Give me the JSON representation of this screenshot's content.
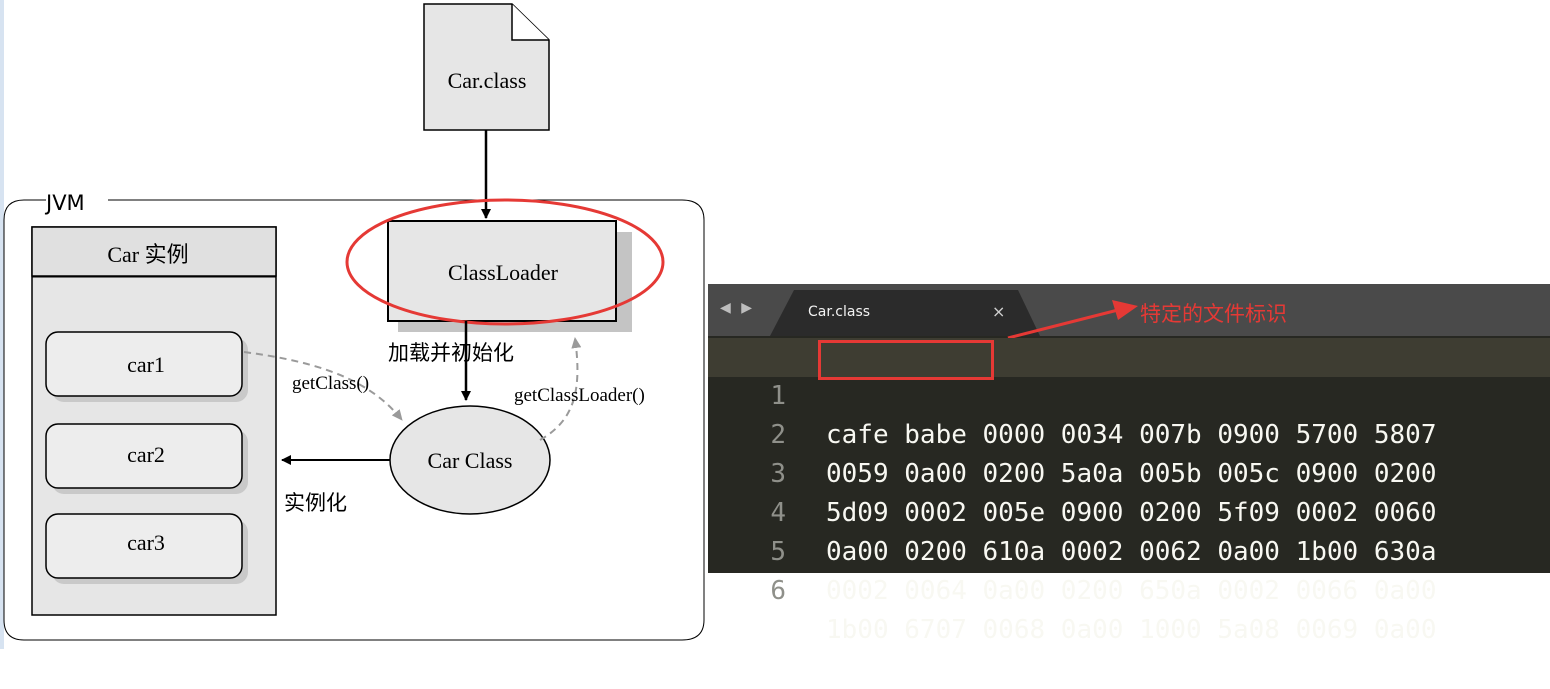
{
  "diagram": {
    "file_label": "Car.class",
    "jvm_label": "JVM",
    "instances_header": "Car 实例",
    "instances": [
      "car1",
      "car2",
      "car3"
    ],
    "classloader_label": "ClassLoader",
    "load_label": "加载并初始化",
    "car_class_label": "Car Class",
    "get_class_label": "getClass()",
    "get_classloader_label": "getClassLoader()",
    "instantiate_label": "实例化",
    "highlight_color": "#e53935"
  },
  "editor": {
    "nav_icons": "◀ ▶",
    "tab_title": "Car.class",
    "tab_close": "×",
    "annotation": "特定的文件标识",
    "lines": [
      {
        "no": "1",
        "text": "cafe babe 0000 0034 007b 0900 5700 5807"
      },
      {
        "no": "2",
        "text": "0059 0a00 0200 5a0a 005b 005c 0900 0200"
      },
      {
        "no": "3",
        "text": "5d09 0002 005e 0900 0200 5f09 0002 0060"
      },
      {
        "no": "4",
        "text": "0a00 0200 610a 0002 0062 0a00 1b00 630a"
      },
      {
        "no": "5",
        "text": "0002 0064 0a00 0200 650a 0002 0066 0a00"
      },
      {
        "no": "6",
        "text": "1b00 6707 0068 0a00 1000 5a08 0069 0a00"
      }
    ]
  }
}
